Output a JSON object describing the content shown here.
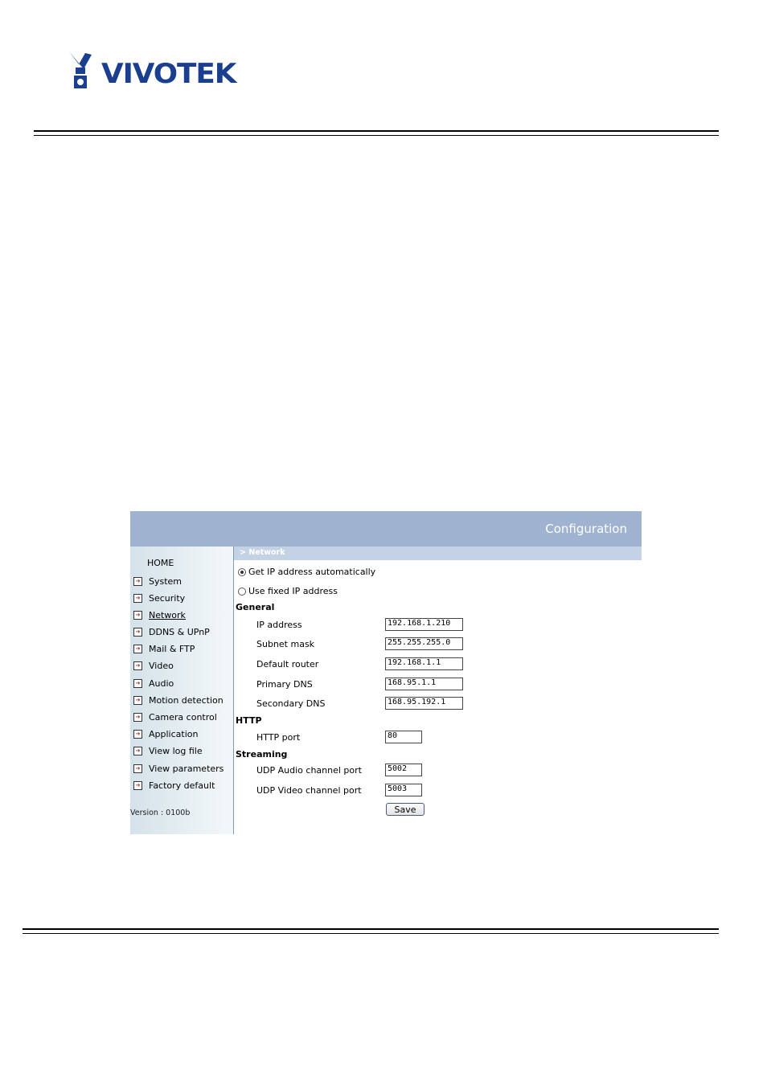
{
  "brand": {
    "logo_text": "VIVOTEK",
    "logo_color": "#1a3f8f"
  },
  "banner": {
    "title": "Configuration",
    "color": "#9fb2cf"
  },
  "breadcrumb": "> Network",
  "sidebar": {
    "home": "HOME",
    "items": [
      {
        "label": "System",
        "icon": "arrow-right-icon"
      },
      {
        "label": "Security",
        "icon": "arrow-right-icon"
      },
      {
        "label": "Network",
        "icon": "arrow-right-icon",
        "active": true
      },
      {
        "label": "DDNS & UPnP",
        "icon": "arrow-right-icon"
      },
      {
        "label": "Mail & FTP",
        "icon": "arrow-right-icon"
      },
      {
        "label": "Video",
        "icon": "arrow-right-icon"
      },
      {
        "label": "Audio",
        "icon": "arrow-right-icon"
      },
      {
        "label": "Motion detection",
        "icon": "arrow-right-icon"
      },
      {
        "label": "Camera control",
        "icon": "arrow-right-icon"
      },
      {
        "label": "Application",
        "icon": "arrow-right-icon"
      },
      {
        "label": "View log file",
        "icon": "arrow-right-icon"
      },
      {
        "label": "View parameters",
        "icon": "arrow-right-icon"
      },
      {
        "label": "Factory default",
        "icon": "arrow-right-icon"
      }
    ],
    "version": "Version : 0100b"
  },
  "network": {
    "option_auto": "Get IP address automatically",
    "option_fixed": "Use fixed IP address",
    "selected": "auto",
    "general_title": "General",
    "ip_label": "IP address",
    "ip_value": "192.168.1.210",
    "subnet_label": "Subnet mask",
    "subnet_value": "255.255.255.0",
    "router_label": "Default router",
    "router_value": "192.168.1.1",
    "dns1_label": "Primary DNS",
    "dns1_value": "168.95.1.1",
    "dns2_label": "Secondary DNS",
    "dns2_value": "168.95.192.1",
    "http_title": "HTTP",
    "http_port_label": "HTTP port",
    "http_port_value": "80",
    "streaming_title": "Streaming",
    "udp_audio_label": "UDP Audio channel port",
    "udp_audio_value": "5002",
    "udp_video_label": "UDP Video channel port",
    "udp_video_value": "5003",
    "save_label": "Save"
  }
}
